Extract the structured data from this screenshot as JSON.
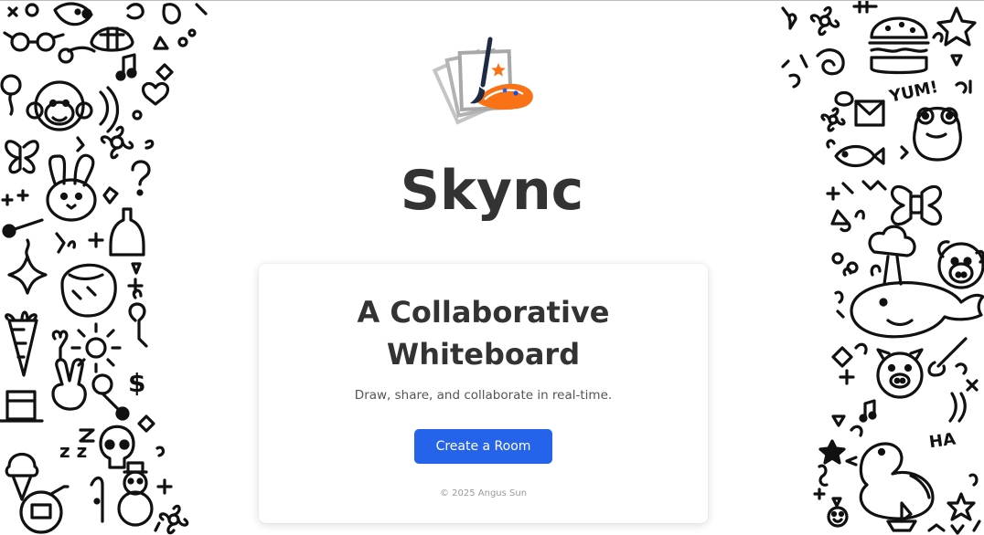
{
  "app": {
    "brand_name": "Skync",
    "logo_icon": "paintbrush-palette-logo"
  },
  "card": {
    "headline_line1": "A Collaborative",
    "headline_line2": "Whiteboard",
    "subtitle": "Draw, share, and collaborate in real-time.",
    "create_button_label": "Create a Room",
    "footer": "© 2025 Angus Sun"
  },
  "colors": {
    "primary": "#2563eb",
    "text": "#333333",
    "subtext": "#555555",
    "muted": "#999999",
    "accent_orange": "#f97316"
  },
  "decorations": {
    "left_panel": "doodle-pattern",
    "right_panel": "doodle-pattern"
  },
  "doodle_words": {
    "yum": "YUM!",
    "ha": "HA",
    "zz": "z z",
    "dollar": "$"
  }
}
